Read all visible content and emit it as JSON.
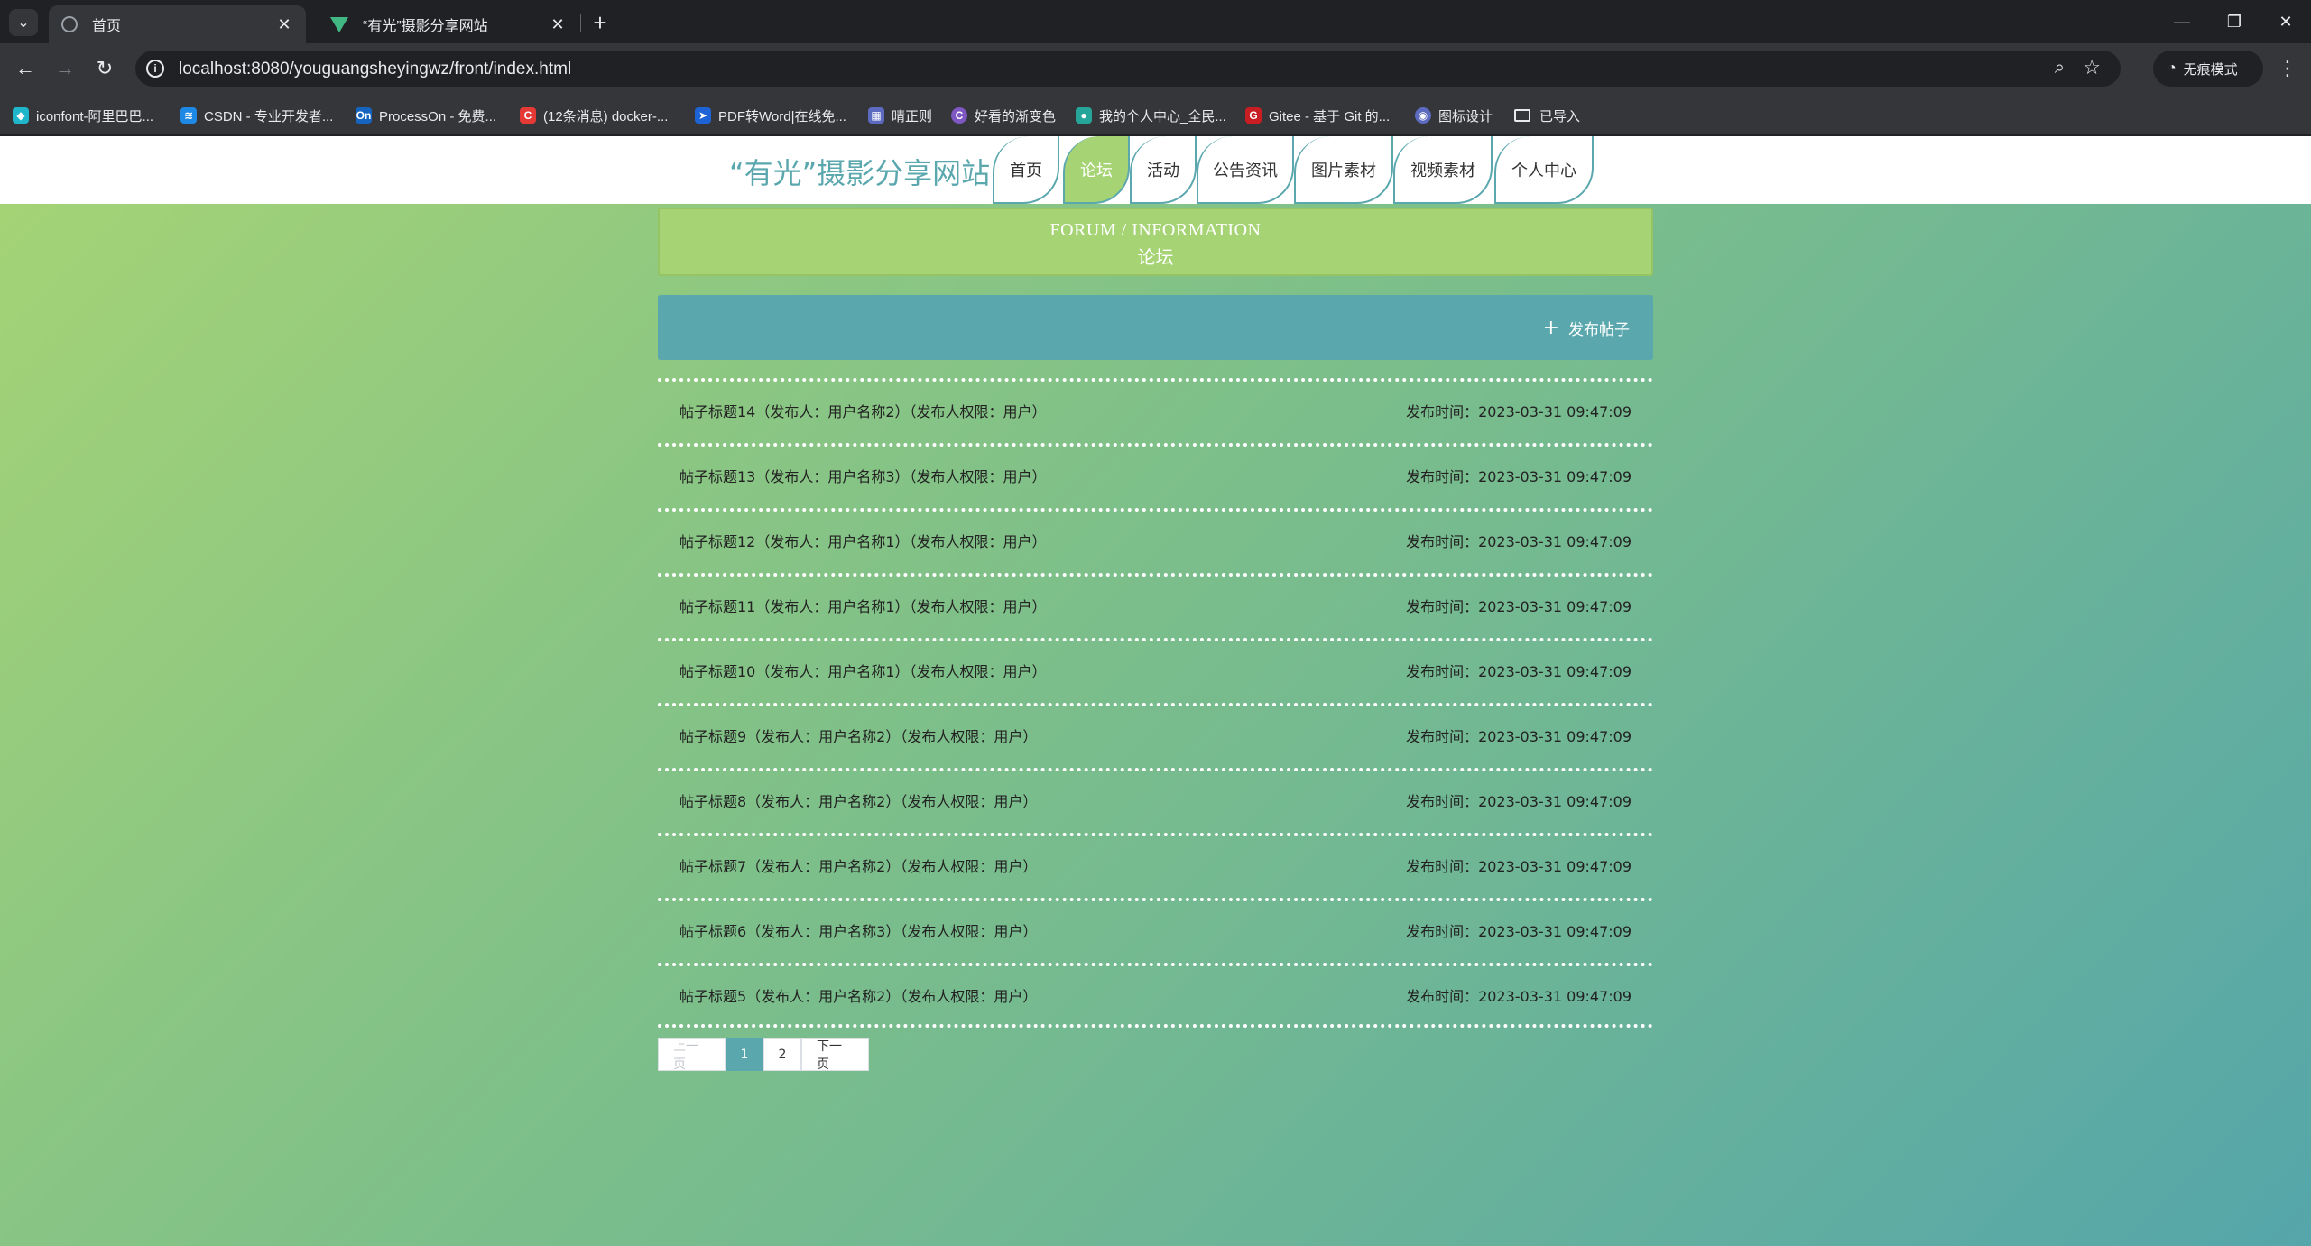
{
  "browser": {
    "tabs": [
      {
        "title": "首页",
        "active": true
      },
      {
        "title": "“有光”摄影分享网站",
        "active": false
      }
    ],
    "url": "localhost:8080/youguangsheyingwz/front/index.html",
    "incognito_label": "无痕模式",
    "bookmarks": [
      {
        "label": "iconfont-阿里巴巴...",
        "icon": "iconfont-icon",
        "color": "#1fb6c9"
      },
      {
        "label": "CSDN - 专业开发者...",
        "icon": "csdn-icon",
        "color": "#1e88e5"
      },
      {
        "label": "ProcessOn - 免费...",
        "icon": "processon-icon",
        "color": "#1565c0",
        "glyph": "On"
      },
      {
        "label": "(12条消息) docker-...",
        "icon": "csdn-c-icon",
        "color": "#e53935",
        "glyph": "C"
      },
      {
        "label": "PDF转Word|在线免...",
        "icon": "pdf-icon",
        "color": "#1e63d6"
      },
      {
        "label": "晴正则",
        "icon": "regex-icon",
        "color": "#5c6bc0"
      },
      {
        "label": "好看的渐变色",
        "icon": "gradient-icon",
        "color": "#7e57c2",
        "glyph": "C"
      },
      {
        "label": "我的个人中心_全民...",
        "icon": "user-center-icon",
        "color": "#26a69a"
      },
      {
        "label": "Gitee - 基于 Git 的...",
        "icon": "gitee-icon",
        "color": "#c71d23",
        "glyph": "G"
      },
      {
        "label": "图标设计",
        "icon": "icon-design-icon",
        "color": "#5c6bc0"
      },
      {
        "label": "已导入",
        "icon": "folder-icon",
        "color": ""
      }
    ]
  },
  "site": {
    "brand": "“有光”摄影分享网站",
    "nav": [
      {
        "label": "首页",
        "active": false
      },
      {
        "label": "论坛",
        "active": true
      },
      {
        "label": "活动",
        "active": false
      },
      {
        "label": "公告资讯",
        "active": false
      },
      {
        "label": "图片素材",
        "active": false
      },
      {
        "label": "视频素材",
        "active": false
      },
      {
        "label": "个人中心",
        "active": false
      }
    ],
    "colors": {
      "accent": "#5aa7ad",
      "active_green": "#a6d475"
    }
  },
  "forum": {
    "banner_en": "FORUM / INFORMATION",
    "banner_cn": "论坛",
    "publish_label": "发布帖子",
    "posts": [
      {
        "title": "帖子标题14（发布人：用户名称2）（发布人权限：用户）",
        "time": "发布时间：2023-03-31 09:47:09"
      },
      {
        "title": "帖子标题13（发布人：用户名称3）（发布人权限：用户）",
        "time": "发布时间：2023-03-31 09:47:09"
      },
      {
        "title": "帖子标题12（发布人：用户名称1）（发布人权限：用户）",
        "time": "发布时间：2023-03-31 09:47:09"
      },
      {
        "title": "帖子标题11（发布人：用户名称1）（发布人权限：用户）",
        "time": "发布时间：2023-03-31 09:47:09"
      },
      {
        "title": "帖子标题10（发布人：用户名称1）（发布人权限：用户）",
        "time": "发布时间：2023-03-31 09:47:09"
      },
      {
        "title": "帖子标题9（发布人：用户名称2）（发布人权限：用户）",
        "time": "发布时间：2023-03-31 09:47:09"
      },
      {
        "title": "帖子标题8（发布人：用户名称2）（发布人权限：用户）",
        "time": "发布时间：2023-03-31 09:47:09"
      },
      {
        "title": "帖子标题7（发布人：用户名称2）（发布人权限：用户）",
        "time": "发布时间：2023-03-31 09:47:09"
      },
      {
        "title": "帖子标题6（发布人：用户名称3）（发布人权限：用户）",
        "time": "发布时间：2023-03-31 09:47:09"
      },
      {
        "title": "帖子标题5（发布人：用户名称2）（发布人权限：用户）",
        "time": "发布时间：2023-03-31 09:47:09"
      }
    ]
  },
  "pagination": {
    "prev": "上一页",
    "pages": [
      "1",
      "2"
    ],
    "current": "1",
    "next": "下一页"
  }
}
